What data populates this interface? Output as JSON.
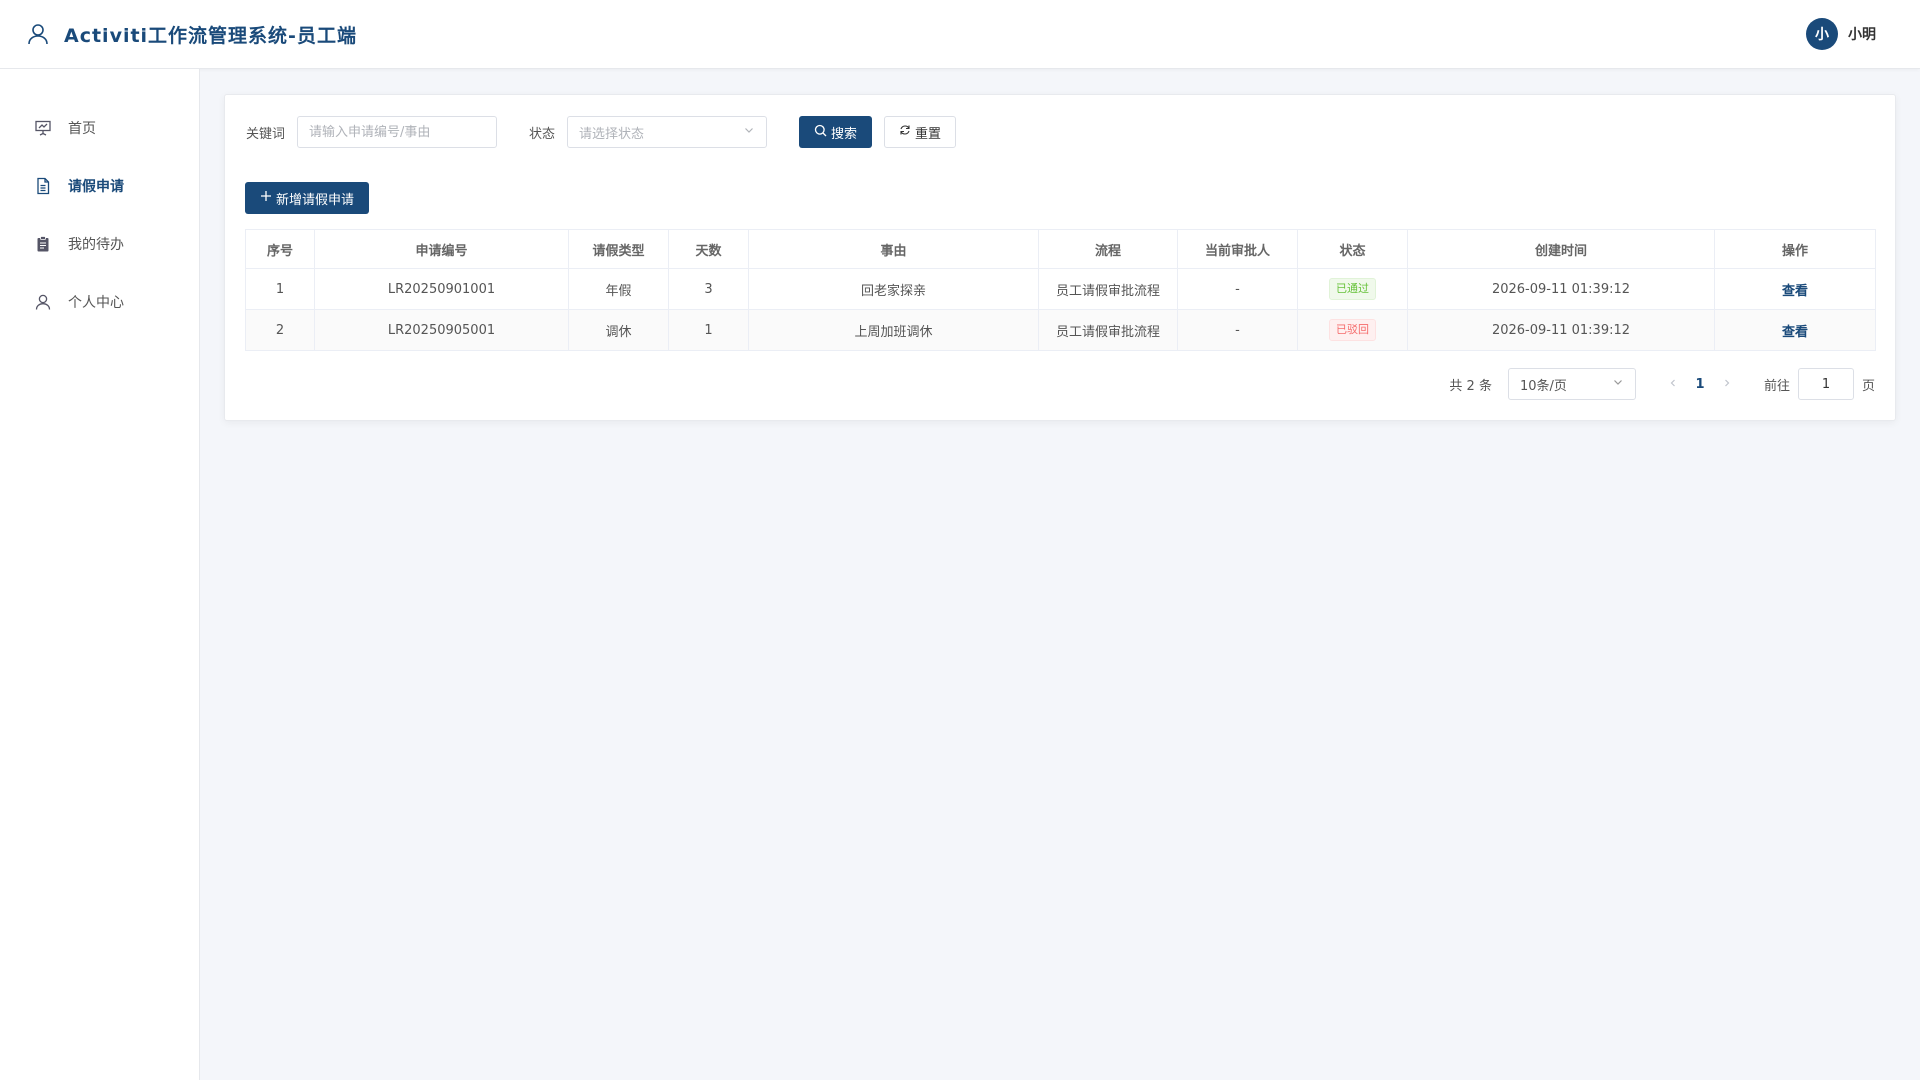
{
  "header": {
    "title": "Activiti工作流管理系统-员工端",
    "user": {
      "avatar_text": "小",
      "name": "小明"
    }
  },
  "sidebar": {
    "items": [
      {
        "label": "首页",
        "icon": "presentation-chart-icon"
      },
      {
        "label": "请假申请",
        "icon": "document-icon",
        "active": true
      },
      {
        "label": "我的待办",
        "icon": "clipboard-icon"
      },
      {
        "label": "个人中心",
        "icon": "user-icon"
      }
    ]
  },
  "filters": {
    "keyword_label": "关键词",
    "keyword_placeholder": "请输入申请编号/事由",
    "status_label": "状态",
    "status_placeholder": "请选择状态",
    "search_label": "搜索",
    "reset_label": "重置"
  },
  "add_button": "新增请假申请",
  "table": {
    "columns": [
      "序号",
      "申请编号",
      "请假类型",
      "天数",
      "事由",
      "流程",
      "当前审批人",
      "状态",
      "创建时间",
      "操作"
    ],
    "rows": [
      {
        "index": "1",
        "code": "LR20250901001",
        "type": "年假",
        "days": "3",
        "reason": "回老家探亲",
        "process": "员工请假审批流程",
        "approver": "-",
        "status": "已通过",
        "status_kind": "success",
        "created": "2026-09-11 01:39:12",
        "action": "查看"
      },
      {
        "index": "2",
        "code": "LR20250905001",
        "type": "调休",
        "days": "1",
        "reason": "上周加班调休",
        "process": "员工请假审批流程",
        "approver": "-",
        "status": "已驳回",
        "status_kind": "danger",
        "created": "2026-09-11 01:39:12",
        "action": "查看"
      }
    ]
  },
  "pagination": {
    "total_text": "共 2 条",
    "page_size": "10条/页",
    "current_page": "1",
    "goto_label": "前往",
    "goto_value": "1",
    "page_suffix": "页"
  },
  "colors": {
    "primary": "#1a4a7a",
    "success": "#67c23a",
    "danger": "#f56c6c"
  }
}
